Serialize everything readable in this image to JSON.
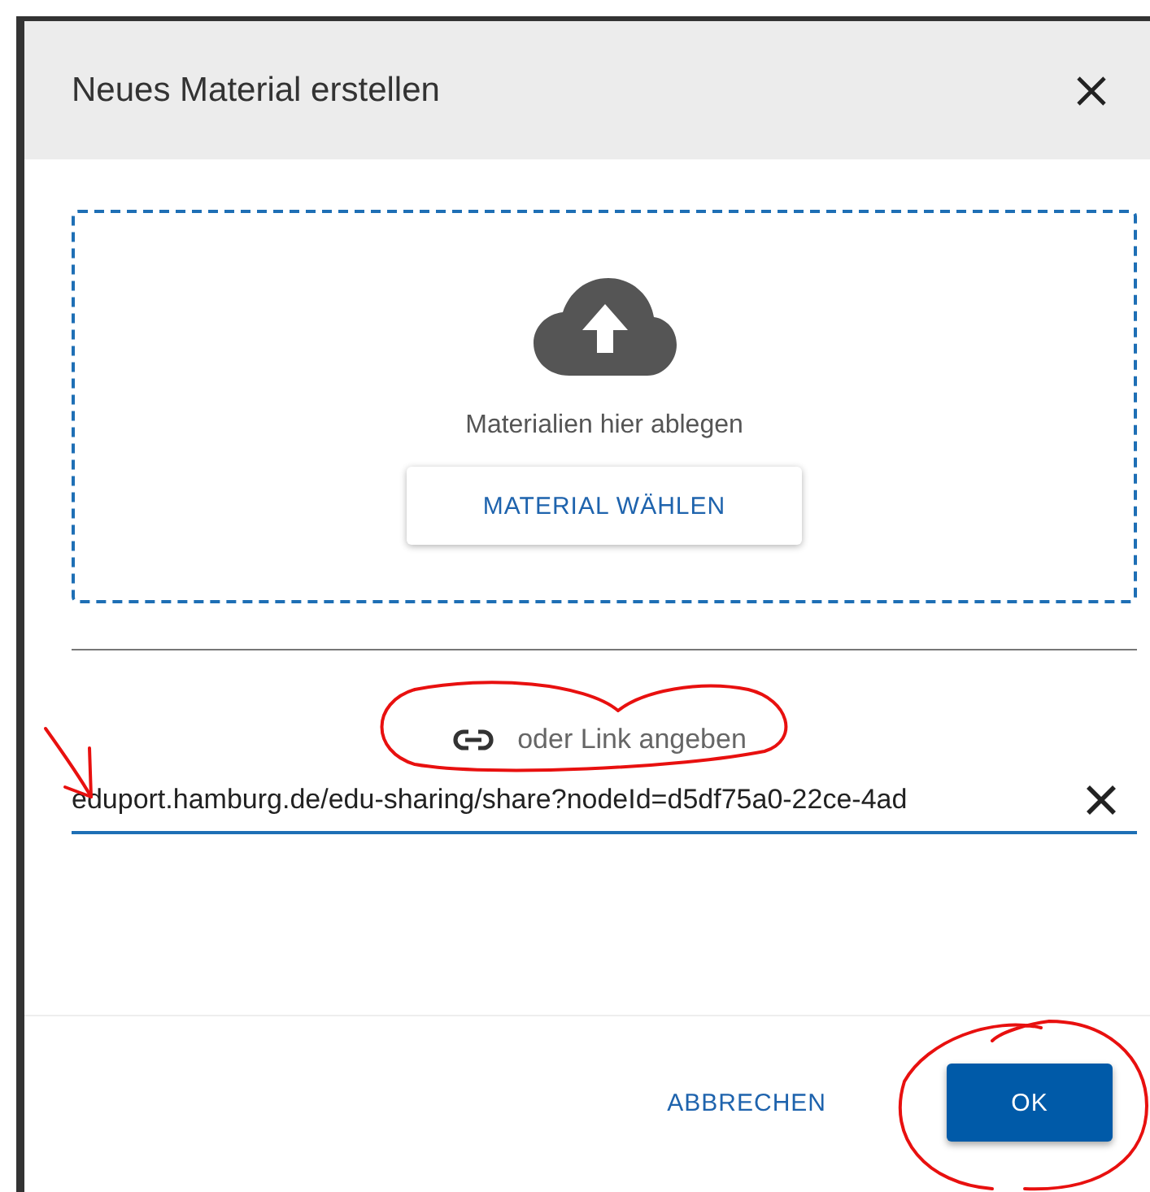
{
  "dialog": {
    "title": "Neues Material erstellen"
  },
  "dropzone": {
    "hint": "Materialien hier ablegen",
    "button": "MATERIAL WÄHLEN"
  },
  "link": {
    "label": "oder Link angeben",
    "value": "eduport.hamburg.de/edu-sharing/share?nodeId=d5df75a0-22ce-4ad"
  },
  "buttons": [
    {
      "label": "ABBRECHEN",
      "kind": "text"
    },
    {
      "label": "OK",
      "kind": "primary"
    }
  ]
}
